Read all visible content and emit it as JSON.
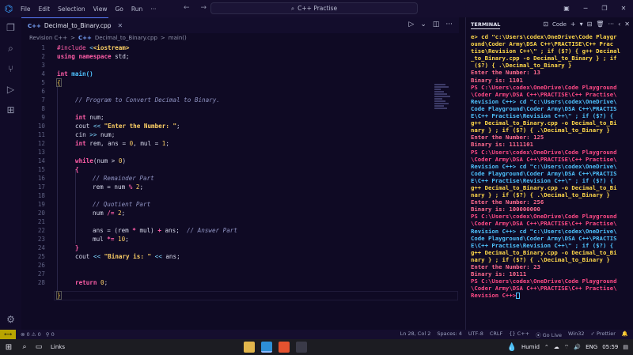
{
  "titlebar": {
    "menu": [
      "File",
      "Edit",
      "Selection",
      "View",
      "Go",
      "Run",
      "···"
    ],
    "search": "C++ Practise",
    "search_icon": "search-icon"
  },
  "editor": {
    "tab": {
      "lang": "C++",
      "name": "Decimal_to_Binary.cpp"
    },
    "breadcrumb": [
      "Revision C++",
      ">",
      "C++",
      "Decimal_to_Binary.cpp",
      ">",
      "main()"
    ],
    "lines": [
      {
        "n": "1"
      },
      {
        "n": "2"
      },
      {
        "n": "3"
      },
      {
        "n": "4"
      },
      {
        "n": "5"
      },
      {
        "n": "6"
      },
      {
        "n": "7"
      },
      {
        "n": "8"
      },
      {
        "n": "9"
      },
      {
        "n": "10"
      },
      {
        "n": "11"
      },
      {
        "n": "12"
      },
      {
        "n": "13"
      },
      {
        "n": "14"
      },
      {
        "n": "15"
      },
      {
        "n": "16"
      },
      {
        "n": "17"
      },
      {
        "n": "18"
      },
      {
        "n": "19"
      },
      {
        "n": "20"
      },
      {
        "n": "21"
      },
      {
        "n": "22"
      },
      {
        "n": "23"
      },
      {
        "n": "24"
      },
      {
        "n": "25"
      },
      {
        "n": "26"
      },
      {
        "n": "27"
      },
      {
        "n": "28"
      }
    ],
    "code": {
      "l1a": "#include",
      "l1b": "<iostream>",
      "l2a": "using",
      "l2b": "namespace",
      "l2c": "std;",
      "l4a": "int",
      "l4b": "main()",
      "l5": "{",
      "l7": "// Program to Convert Decimal to Binary.",
      "l9a": "int",
      "l9b": "num;",
      "l10a": "cout",
      "l10b": "<<",
      "l10c": "\"Enter the Number: \"",
      "l10d": ";",
      "l11a": "cin",
      "l11b": ">>",
      "l11c": "num;",
      "l12a": "int",
      "l12b": "rem, ans =",
      "l12c": "0",
      "l12d": ", mul =",
      "l12e": "1",
      "l12f": ";",
      "l14a": "while",
      "l14b": "(num >",
      "l14c": "0",
      "l14d": ")",
      "l15": "{",
      "l16": "// Remainder Part",
      "l17a": "rem = num",
      "l17b": "%",
      "l17c": "2",
      "l17d": ";",
      "l19": "// Quotient Part",
      "l20a": "num",
      "l20b": "/=",
      "l20c": "2",
      "l20d": ";",
      "l22a": "ans = (rem",
      "l22b": "*",
      "l22c": "mul)",
      "l22d": "+",
      "l22e": "ans;",
      "l22f": "// Answer Part",
      "l23a": "mul",
      "l23b": "*=",
      "l23c": "10",
      "l23d": ";",
      "l24": "}",
      "l25a": "cout",
      "l25b": "<<",
      "l25c": "\"Binary is: \"",
      "l25d": "<<",
      "l25e": "ans;",
      "l27a": "return",
      "l27b": "0",
      "l27c": ";",
      "l28": "}"
    }
  },
  "terminal": {
    "title": "TERMINAL",
    "profile": "Code",
    "tools": [
      "+",
      "▾",
      "⊟",
      "🗑",
      "···",
      "‹",
      "✕"
    ],
    "lines": [
      "e> cd \"c:\\Users\\codex\\OneDrive\\Code Playgr",
      "ound\\Coder Army\\DSA C++\\PRACTISE\\C++ Prac",
      "tise\\Revision C++\\\" ; if ($?) { g++ Decimal",
      "_to_Binary.cpp -o Decimal_to_Binary } ; if",
      " ($?) { .\\Decimal_to_Binary }",
      "Enter the Number: 13",
      "Binary is: 1101",
      "PS C:\\Users\\codex\\OneDrive\\Code Playground",
      "\\Coder Army\\DSA C++\\PRACTISE\\C++ Practise\\",
      "Revision C++> cd \"c:\\Users\\codex\\OneDrive\\",
      "Code Playground\\Coder Army\\DSA C++\\PRACTIS",
      "E\\C++ Practise\\Revision C++\\\" ; if ($?) {",
      "g++ Decimal_to_Binary.cpp -o Decimal_to_Bi",
      "nary } ; if ($?) { .\\Decimal_to_Binary }",
      "Enter the Number: 125",
      "Binary is: 1111101",
      "PS C:\\Users\\codex\\OneDrive\\Code Playground",
      "\\Coder Army\\DSA C++\\PRACTISE\\C++ Practise\\",
      "Revision C++> cd \"c:\\Users\\codex\\OneDrive\\",
      "Code Playground\\Coder Army\\DSA C++\\PRACTIS",
      "E\\C++ Practise\\Revision C++\\\" ; if ($?) {",
      "g++ Decimal_to_Binary.cpp -o Decimal_to_Bi",
      "nary } ; if ($?) { .\\Decimal_to_Binary }",
      "Enter the Number: 256",
      "Binary is: 100000000",
      "PS C:\\Users\\codex\\OneDrive\\Code Playground",
      "\\Coder Army\\DSA C++\\PRACTISE\\C++ Practise\\",
      "Revision C++> cd \"c:\\Users\\codex\\OneDrive\\",
      "Code Playground\\Coder Army\\DSA C++\\PRACTIS",
      "E\\C++ Practise\\Revision C++\\\" ; if ($?) {",
      "g++ Decimal_to_Binary.cpp -o Decimal_to_Bi",
      "nary } ; if ($?) { .\\Decimal_to_Binary }",
      "Enter the Number: 23",
      "Binary is: 10111",
      "PS C:\\Users\\codex\\OneDrive\\Code Playground",
      "\\Coder Army\\DSA C++\\PRACTISE\\C++ Practise\\",
      "Revision C++>"
    ]
  },
  "status": {
    "errors": "⊗ 0 ⚠ 0",
    "ports": "⚲ 0",
    "position": "Ln 28, Col 2",
    "spaces": "Spaces: 4",
    "encoding": "UTF-8",
    "eol": "CRLF",
    "lang": "{} C++",
    "golive": "⦿ Go Live",
    "platform": "Win32",
    "prettier": "✓ Prettier"
  },
  "taskbar": {
    "links": "Links",
    "weather": "Humid",
    "lang": "ENG",
    "time": "05:59"
  }
}
